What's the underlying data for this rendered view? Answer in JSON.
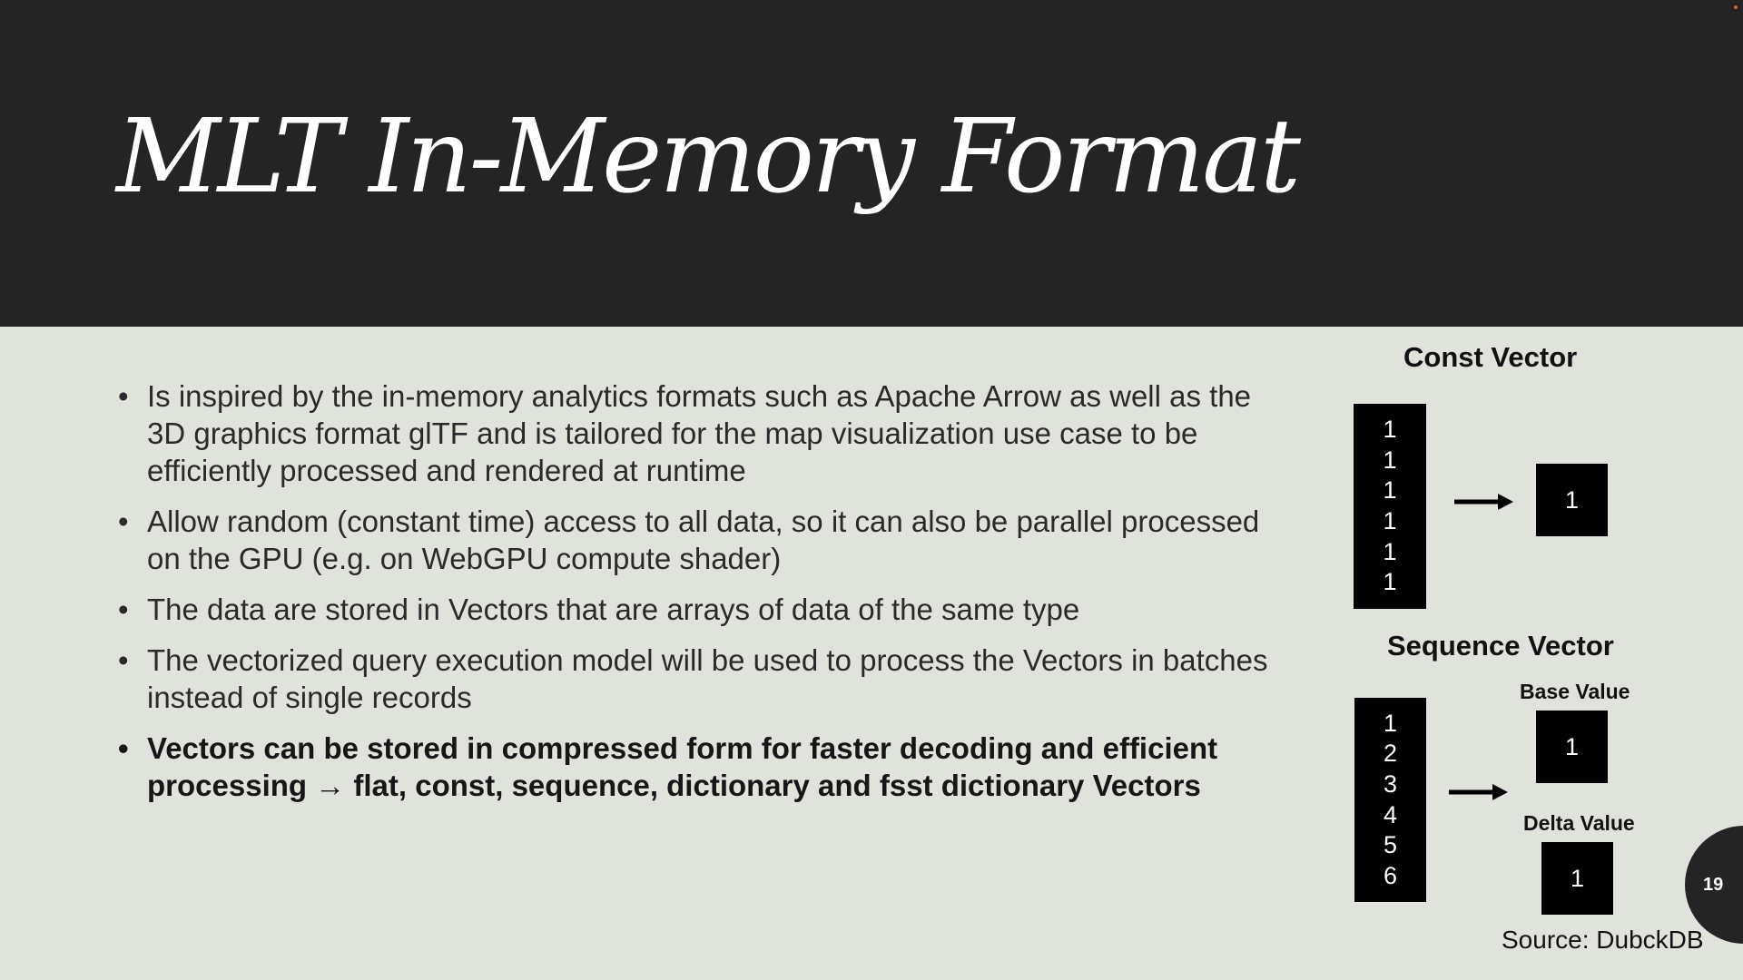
{
  "slide": {
    "title": "MLT In-Memory Format",
    "bullet_marker": "•",
    "bullets": [
      {
        "text": "Is inspired by the in-memory analytics formats such as Apache Arrow as well as the 3D graphics format glTF and is tailored for the map visualization use case to be efficiently processed and rendered at runtime"
      },
      {
        "text": "Allow random (constant time) access to all data, so it can also be parallel processed on the GPU (e.g. on WebGPU compute shader)"
      },
      {
        "text": "The data are stored in Vectors that are arrays of data of the same type"
      },
      {
        "text": "The vectorized query execution model will be used to process the Vectors in batches instead of single records"
      },
      {
        "text": "Vectors can be stored in compressed form for faster decoding and efficient processing → flat, const, sequence, dictionary and fsst dictionary Vectors"
      }
    ],
    "const_vector": {
      "heading": "Const Vector",
      "values": [
        "1",
        "1",
        "1",
        "1",
        "1",
        "1"
      ],
      "result": "1"
    },
    "sequence_vector": {
      "heading": "Sequence Vector",
      "values": [
        "1",
        "2",
        "3",
        "4",
        "5",
        "6"
      ],
      "base_label": "Base Value",
      "base_value": "1",
      "delta_label": "Delta Value",
      "delta_value": "1"
    },
    "source": "Source: DubckDB",
    "page_number": "19"
  },
  "colors": {
    "header_background": "#242424",
    "body_background": "#e0e3dc",
    "box_fill": "#000000"
  },
  "icons": [
    "right-arrow-icon"
  ]
}
